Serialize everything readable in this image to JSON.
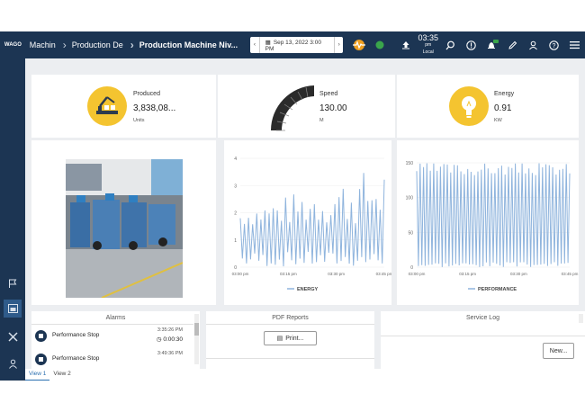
{
  "header": {
    "logo_text": "WAGO",
    "breadcrumbs": [
      "Machin",
      "Production De",
      "Production Machine Niv..."
    ],
    "date_range": "Sep 13, 2022 3:00 PM",
    "clock": {
      "time": "03:35",
      "ampm": "pm",
      "zone": "Local"
    },
    "icons": [
      "heartbeat-icon",
      "status-dot-icon",
      "upload-icon",
      "search-icon",
      "info-icon",
      "alarm-bell-icon",
      "edit-icon",
      "user-icon",
      "help-icon",
      "menu-icon"
    ]
  },
  "sidebar": {
    "items": [
      "flag-icon",
      "dashboard-icon",
      "tools-icon",
      "account-icon"
    ]
  },
  "kpis": [
    {
      "label": "Produced",
      "value": "3,838,08...",
      "unit": "Units",
      "icon": "robot-arm-icon"
    },
    {
      "label": "Speed",
      "value": "130.00",
      "unit": "M",
      "icon": "conveyor-icon"
    },
    {
      "label": "Energy",
      "value": "0.91",
      "unit": "KW",
      "icon": "lightbulb-icon"
    }
  ],
  "energy_chart": {
    "legend": "ENERGY",
    "yticks": [
      "0",
      "1",
      "2",
      "3",
      "4"
    ],
    "xticks": [
      "03:00 pm",
      "03:15 pm",
      "03:30 pm",
      "03:45 pm"
    ],
    "color": "#8fb4dd"
  },
  "performance_chart": {
    "legend": "PERFORMANCE",
    "yticks": [
      "0",
      "50",
      "100",
      "150"
    ],
    "xticks": [
      "03:00 pm",
      "03:15 pm",
      "03:30 pm",
      "03:45 pm"
    ],
    "color": "#8fb4dd"
  },
  "alarms": {
    "title": "Alarms",
    "rows": [
      {
        "name": "Performance Stop",
        "time": "3:35:26 PM",
        "duration": "0:00:30"
      },
      {
        "name": "Performance Stop",
        "time": "3:49:36 PM",
        "duration": ""
      }
    ]
  },
  "pdf_reports": {
    "title": "PDF Reports",
    "button": "Print..."
  },
  "service_log": {
    "title": "Service Log",
    "button": "New..."
  },
  "tabs": [
    "View 1",
    "View 2"
  ]
}
